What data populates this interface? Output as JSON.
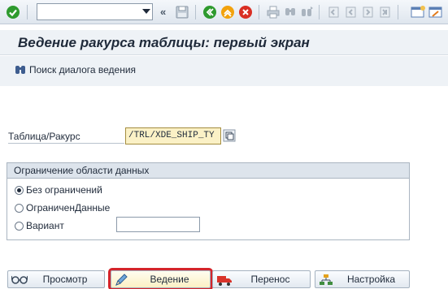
{
  "toolbar": {
    "command_value": "",
    "icons": [
      "enter-check-icon",
      "back-arrows-icon",
      "save-icon",
      "back-icon",
      "exit-icon",
      "cancel-icon",
      "print-icon",
      "find-icon",
      "find-next-icon",
      "first-page-icon",
      "prev-page-icon",
      "next-page-icon",
      "last-page-icon",
      "new-session-icon",
      "shortcut-icon"
    ],
    "colors": {
      "enter": "#2e9a2e",
      "back": "#2e9a2e",
      "exit": "#f2a20d",
      "cancel": "#d92f24"
    }
  },
  "title": "Ведение ракурса таблицы: первый экран",
  "app_toolbar": {
    "find_dialog_label": "Поиск диалога ведения"
  },
  "form": {
    "table_label": "Таблица/Ракурс",
    "table_value": "/TRL/XDE_SHIP_TY",
    "group_title": "Ограничение области данных",
    "options": [
      {
        "label": "Без ограничений",
        "selected": true
      },
      {
        "label": "ОграниченДанные",
        "selected": false
      },
      {
        "label": "Вариант",
        "selected": false
      }
    ],
    "variant_value": ""
  },
  "buttons": {
    "display": "Просмотр",
    "maintain": "Ведение",
    "transport": "Перенос",
    "customizing": "Настройка"
  },
  "highlight_color": "#d4242a"
}
